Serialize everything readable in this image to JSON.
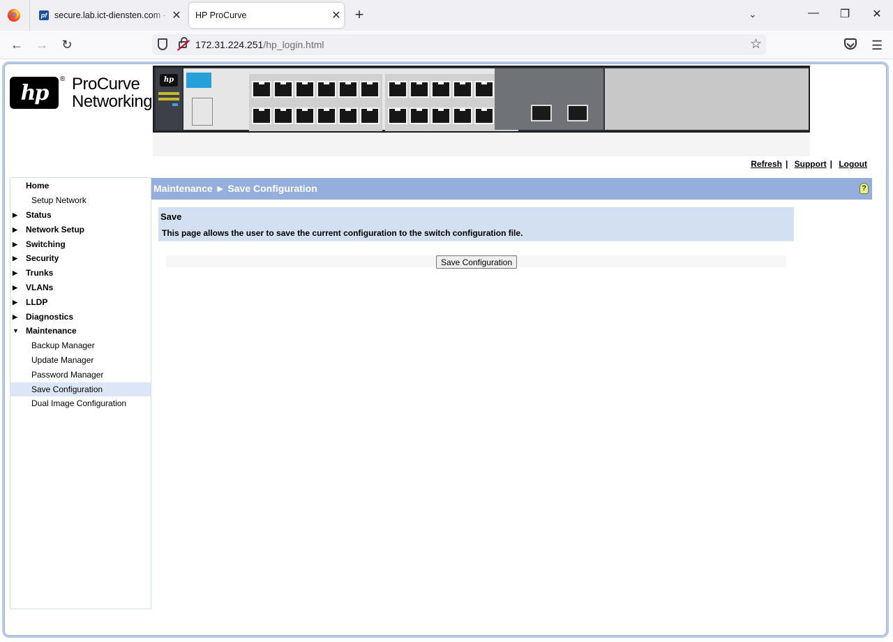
{
  "browser": {
    "tabs": [
      {
        "title": "secure.lab.ict-diensten.com - St",
        "favicon": "pf",
        "close": "✕"
      },
      {
        "title": "HP ProCurve",
        "close": "✕"
      }
    ],
    "new_tab": "+",
    "tab_list": "⌄",
    "window": {
      "minimize": "—",
      "restore": "❐",
      "close": "✕"
    },
    "url_host": "172.31.224.251",
    "url_path": "/hp_login.html",
    "nav": {
      "back": "←",
      "forward": "→",
      "reload": "↻",
      "bookmark": "☆",
      "menu": "☰"
    }
  },
  "header": {
    "logo_text": "hp",
    "registered": "®",
    "brand_line1": "ProCurve",
    "brand_line2": "Networking"
  },
  "toplinks": {
    "refresh": "Refresh",
    "support": "Support",
    "logout": "Logout",
    "separator": "|"
  },
  "sidebar": {
    "items": [
      {
        "label": "Home",
        "type": "top"
      },
      {
        "label": "Setup Network",
        "type": "sub"
      },
      {
        "label": "Status",
        "type": "group",
        "arrow": "▶"
      },
      {
        "label": "Network Setup",
        "type": "group",
        "arrow": "▶"
      },
      {
        "label": "Switching",
        "type": "group",
        "arrow": "▶"
      },
      {
        "label": "Security",
        "type": "group",
        "arrow": "▶"
      },
      {
        "label": "Trunks",
        "type": "group",
        "arrow": "▶"
      },
      {
        "label": "VLANs",
        "type": "group",
        "arrow": "▶"
      },
      {
        "label": "LLDP",
        "type": "group",
        "arrow": "▶"
      },
      {
        "label": "Diagnostics",
        "type": "group",
        "arrow": "▶"
      },
      {
        "label": "Maintenance",
        "type": "group",
        "arrow": "▼"
      },
      {
        "label": "Backup Manager",
        "type": "sub"
      },
      {
        "label": "Update Manager",
        "type": "sub"
      },
      {
        "label": "Password Manager",
        "type": "sub"
      },
      {
        "label": "Save Configuration",
        "type": "sub",
        "active": true
      },
      {
        "label": "Dual Image Configuration",
        "type": "sub"
      }
    ]
  },
  "main": {
    "title": "Maintenance ► Save Configuration",
    "help": "?",
    "section_title": "Save",
    "section_desc": "This page allows the user to save the current configuration to the switch configuration file.",
    "button": "Save Configuration"
  },
  "switch_image": {
    "hp": "hp",
    "lit_port": 17
  },
  "colors": {
    "title_bar": "#96aedb",
    "section_bg": "#d3e0f1",
    "active_nav": "#dce6f6",
    "lit_port": "#7ee22a"
  }
}
